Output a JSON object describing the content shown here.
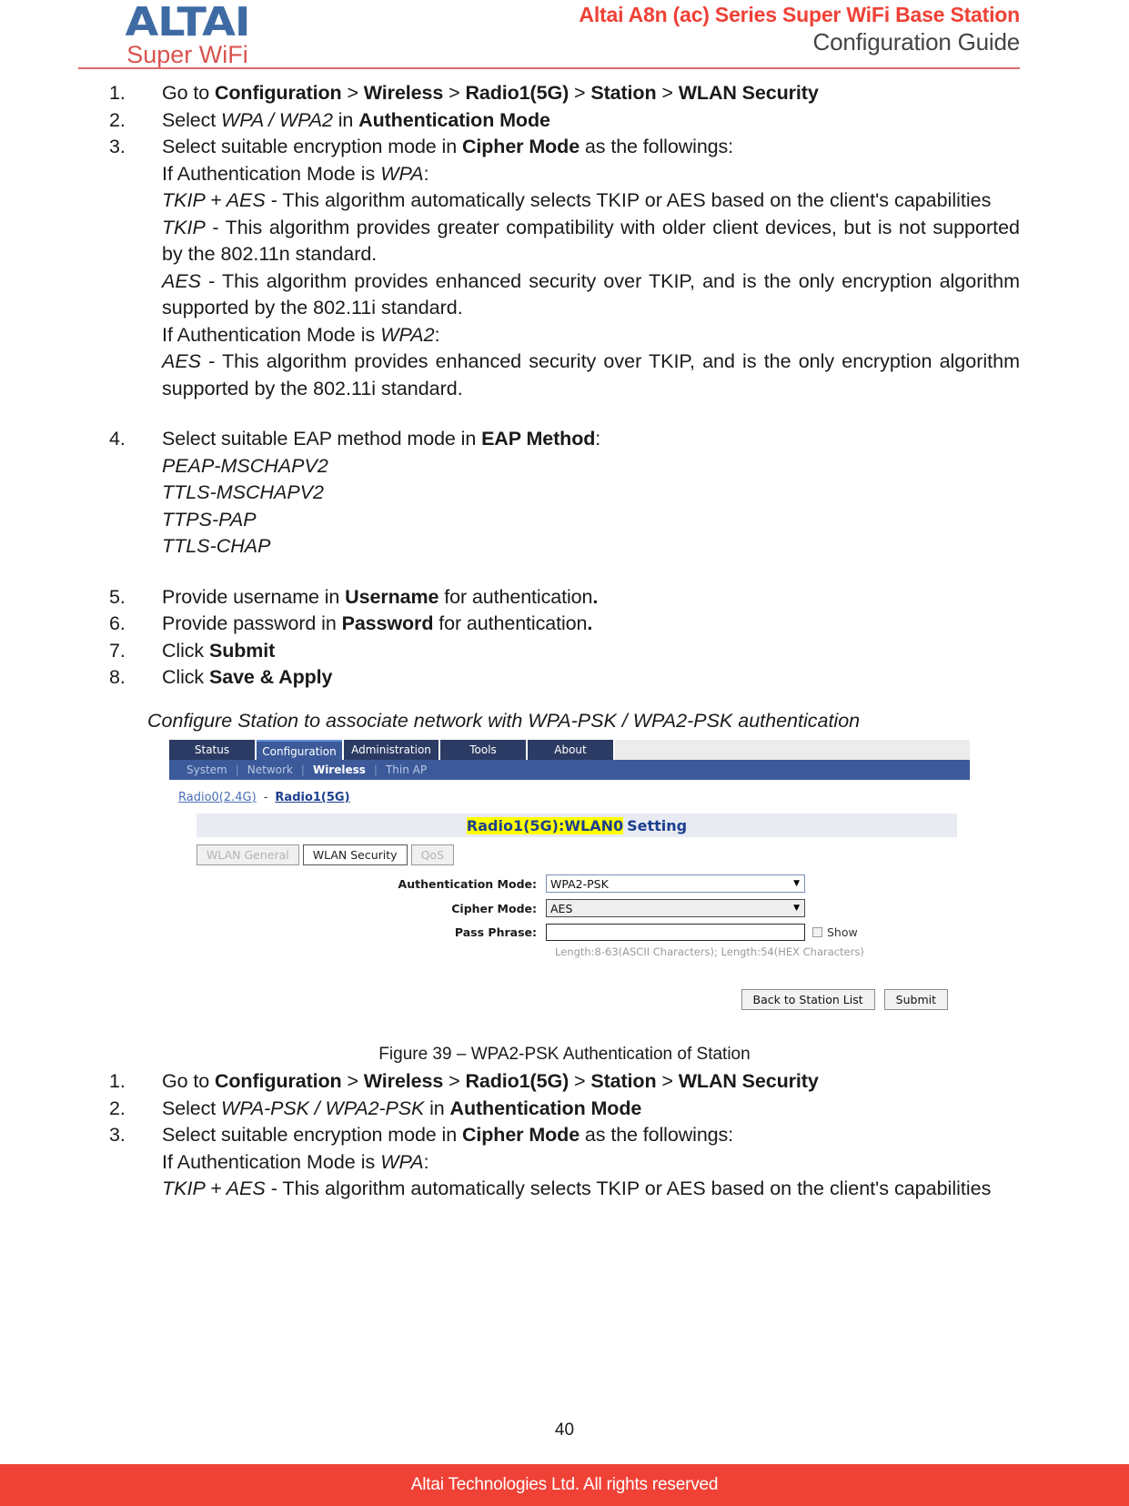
{
  "header": {
    "logo_main": "ALTAI",
    "logo_sub": "Super WiFi",
    "title_line1": "Altai A8n (ac) Series Super WiFi Base Station",
    "title_line2": "Configuration Guide"
  },
  "steps_top": [
    {
      "num": "1.",
      "parts": [
        {
          "t": "Go to ",
          "s": "n"
        },
        {
          "t": "Configuration",
          "s": "b"
        },
        {
          "t": " > ",
          "s": "n"
        },
        {
          "t": "Wireless",
          "s": "b"
        },
        {
          "t": " > ",
          "s": "n"
        },
        {
          "t": "Radio1(5G)",
          "s": "b"
        },
        {
          "t": " > ",
          "s": "n"
        },
        {
          "t": "Station",
          "s": "b"
        },
        {
          "t": " > ",
          "s": "n"
        },
        {
          "t": "WLAN Security",
          "s": "b"
        }
      ]
    },
    {
      "num": "2.",
      "parts": [
        {
          "t": "Select ",
          "s": "n"
        },
        {
          "t": "WPA / WPA2",
          "s": "i"
        },
        {
          "t": " in ",
          "s": "n"
        },
        {
          "t": "Authentication Mode",
          "s": "b"
        }
      ]
    },
    {
      "num": "3.",
      "parts": [
        {
          "t": "Select suitable encryption mode in ",
          "s": "n"
        },
        {
          "t": "Cipher Mode",
          "s": "b"
        },
        {
          "t": " as the followings:",
          "s": "n"
        }
      ]
    }
  ],
  "cipher_lines": [
    [
      {
        "t": "If Authentication Mode is ",
        "s": "n"
      },
      {
        "t": "WPA",
        "s": "i"
      },
      {
        "t": ":",
        "s": "n"
      }
    ],
    [
      {
        "t": "TKIP + AES",
        "s": "i"
      },
      {
        "t": " - This algorithm automatically selects TKIP or AES based on the client's capabilities",
        "s": "n"
      }
    ],
    [
      {
        "t": "TKIP",
        "s": "i"
      },
      {
        "t": " - This algorithm provides greater compatibility with older client devices, but is not supported by the 802.11n standard.",
        "s": "n"
      }
    ],
    [
      {
        "t": "AES",
        "s": "i"
      },
      {
        "t": " - This algorithm provides enhanced security over TKIP, and is the only encryption algorithm supported by the 802.11i standard.",
        "s": "n"
      }
    ],
    [
      {
        "t": "If Authentication Mode is ",
        "s": "n"
      },
      {
        "t": "WPA2",
        "s": "i"
      },
      {
        "t": ":",
        "s": "n"
      }
    ],
    [
      {
        "t": "AES",
        "s": "i"
      },
      {
        "t": " - This algorithm provides enhanced security over TKIP, and is the only encryption algorithm supported by the 802.11i standard.",
        "s": "n"
      }
    ]
  ],
  "step4": {
    "num": "4.",
    "parts": [
      {
        "t": "Select suitable EAP method mode in ",
        "s": "n"
      },
      {
        "t": "EAP Method",
        "s": "b"
      },
      {
        "t": ":",
        "s": "n"
      }
    ]
  },
  "eap_methods": [
    "PEAP-MSCHAPV2",
    "TTLS-MSCHAPV2",
    "TTPS-PAP",
    "TTLS-CHAP"
  ],
  "steps_bottom": [
    {
      "num": "5.",
      "parts": [
        {
          "t": "Provide username in ",
          "s": "n"
        },
        {
          "t": "Username",
          "s": "b"
        },
        {
          "t": " for authentication",
          "s": "n"
        },
        {
          "t": ".",
          "s": "b"
        }
      ]
    },
    {
      "num": "6.",
      "parts": [
        {
          "t": "Provide password in ",
          "s": "n"
        },
        {
          "t": "Password",
          "s": "b"
        },
        {
          "t": " for authentication",
          "s": "n"
        },
        {
          "t": ".",
          "s": "b"
        }
      ]
    },
    {
      "num": "7.",
      "parts": [
        {
          "t": "Click ",
          "s": "n"
        },
        {
          "t": "Submit",
          "s": "b"
        }
      ]
    },
    {
      "num": "8.",
      "parts": [
        {
          "t": "Click ",
          "s": "n"
        },
        {
          "t": "Save & Apply",
          "s": "b"
        }
      ]
    }
  ],
  "figure_intro": "Configure Station to associate network with WPA-PSK / WPA2-PSK authentication",
  "ui": {
    "main_tabs": [
      {
        "label": "Status",
        "active": false
      },
      {
        "label": "Configuration",
        "active": true
      },
      {
        "label": "Administration",
        "active": false
      },
      {
        "label": "Tools",
        "active": false
      },
      {
        "label": "About",
        "active": false
      }
    ],
    "sub_nav": [
      {
        "label": "System",
        "active": false
      },
      {
        "label": "Network",
        "active": false
      },
      {
        "label": "Wireless",
        "active": true
      },
      {
        "label": "Thin AP",
        "active": false
      }
    ],
    "radio_links": [
      {
        "label": "Radio0(2.4G)",
        "active": false
      },
      {
        "label": "Radio1(5G)",
        "active": true
      }
    ],
    "radio_separator": "-",
    "setting_title_highlight": "Radio1(5G):WLAN0",
    "setting_title_plain": "Setting",
    "sub_tabs": [
      {
        "label": "WLAN General",
        "active": false
      },
      {
        "label": "WLAN Security",
        "active": true
      },
      {
        "label": "QoS",
        "active": false
      }
    ],
    "form": {
      "auth_mode_label": "Authentication Mode:",
      "auth_mode_value": "WPA2-PSK",
      "cipher_mode_label": "Cipher Mode:",
      "cipher_mode_value": "AES",
      "pass_phrase_label": "Pass Phrase:",
      "pass_phrase_value": "",
      "show_label": "Show",
      "length_hint": "Length:8-63(ASCII Characters); Length:54(HEX Characters)"
    },
    "buttons": {
      "back": "Back to Station List",
      "submit": "Submit"
    }
  },
  "figure_caption": "Figure 39 – WPA2-PSK Authentication of Station",
  "steps_after_figure": [
    {
      "num": "1.",
      "parts": [
        {
          "t": "Go to ",
          "s": "n"
        },
        {
          "t": "Configuration",
          "s": "b"
        },
        {
          "t": " > ",
          "s": "n"
        },
        {
          "t": "Wireless",
          "s": "b"
        },
        {
          "t": " > ",
          "s": "n"
        },
        {
          "t": "Radio1(5G)",
          "s": "b"
        },
        {
          "t": " > ",
          "s": "n"
        },
        {
          "t": "Station",
          "s": "b"
        },
        {
          "t": " > ",
          "s": "n"
        },
        {
          "t": "WLAN Security",
          "s": "b"
        }
      ]
    },
    {
      "num": "2.",
      "parts": [
        {
          "t": "Select ",
          "s": "n"
        },
        {
          "t": "WPA-PSK / WPA2-PSK",
          "s": "i"
        },
        {
          "t": " in ",
          "s": "n"
        },
        {
          "t": "Authentication Mode",
          "s": "b"
        }
      ]
    },
    {
      "num": "3.",
      "parts": [
        {
          "t": "Select suitable encryption mode in ",
          "s": "n"
        },
        {
          "t": "Cipher Mode",
          "s": "b"
        },
        {
          "t": " as the followings:",
          "s": "n"
        }
      ]
    }
  ],
  "cipher_lines_after": [
    [
      {
        "t": "If Authentication Mode is ",
        "s": "n"
      },
      {
        "t": "WPA",
        "s": "i"
      },
      {
        "t": ":",
        "s": "n"
      }
    ],
    [
      {
        "t": "TKIP + AES",
        "s": "i"
      },
      {
        "t": " - This algorithm automatically selects TKIP or AES based on the client's capabilities",
        "s": "n"
      }
    ]
  ],
  "footer": {
    "page_number": "40",
    "copyright": "Altai Technologies Ltd. All rights reserved"
  },
  "colors": {
    "brand_red": "#ef4136",
    "logo_blue": "#3f6ba4",
    "ui_navy": "#2b3b63",
    "ui_blue": "#3c5a9a",
    "highlight_yellow": "#ffff00"
  }
}
